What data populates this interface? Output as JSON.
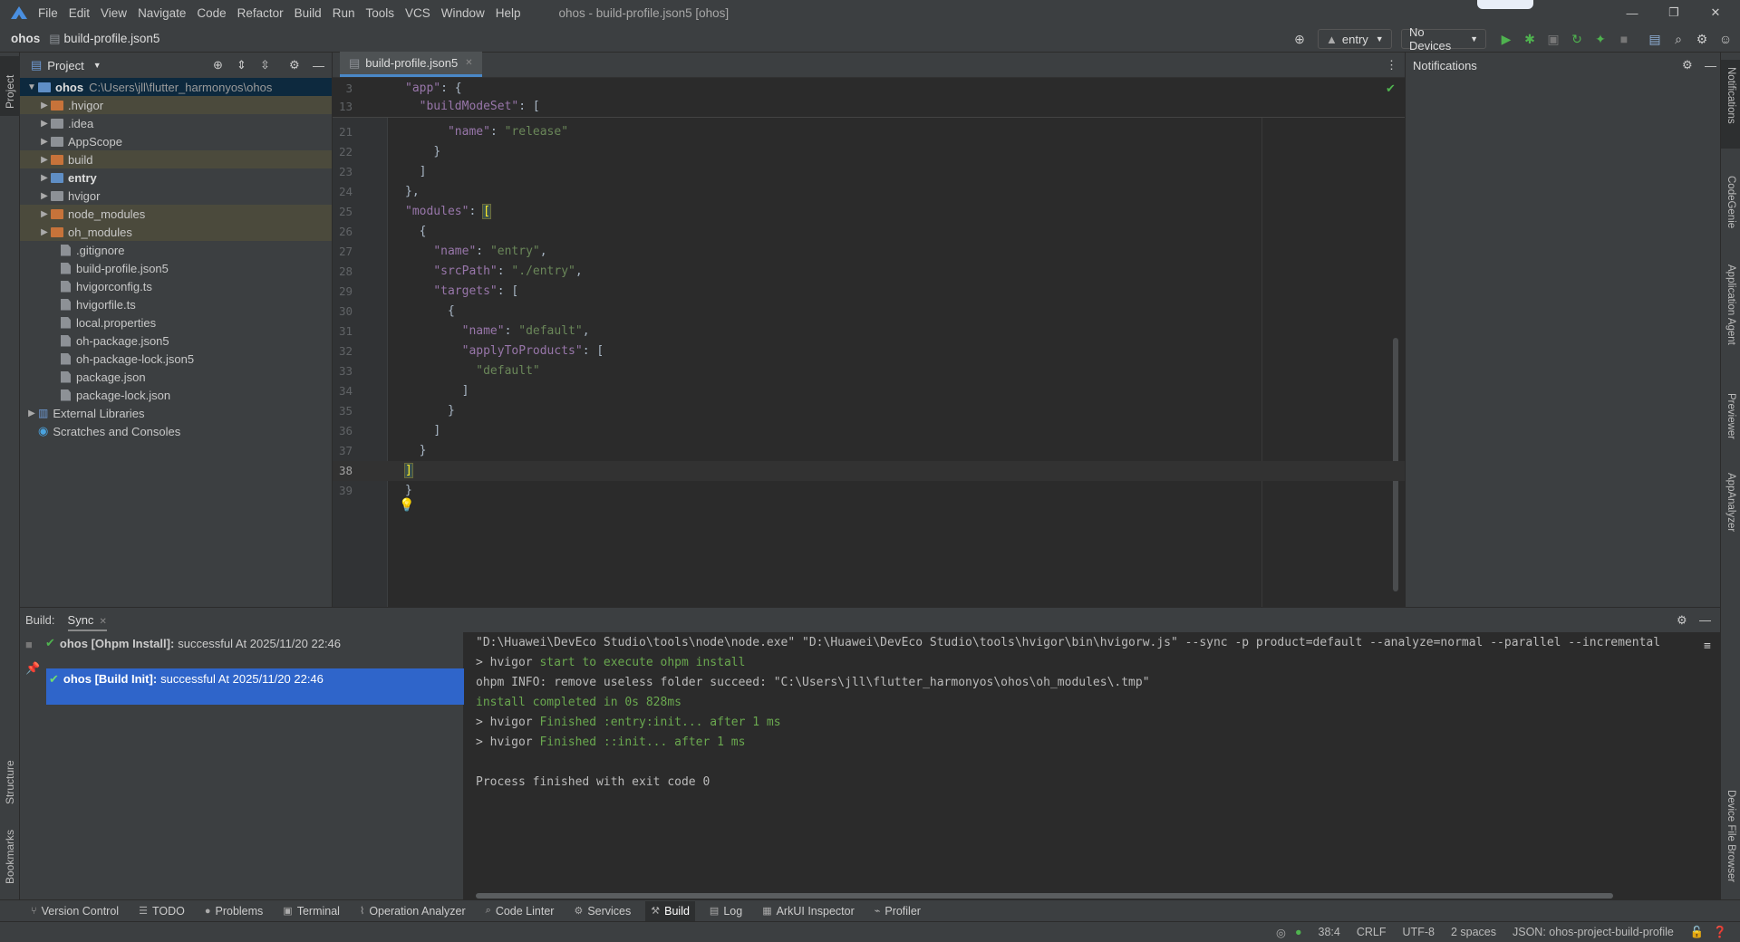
{
  "menubar": {
    "items": [
      "File",
      "Edit",
      "View",
      "Navigate",
      "Code",
      "Refactor",
      "Build",
      "Run",
      "Tools",
      "VCS",
      "Window",
      "Help"
    ],
    "window_title": "ohos - build-profile.json5 [ohos]"
  },
  "navbar": {
    "project": "ohos",
    "file": "build-profile.json5",
    "run_config": "entry",
    "device": "No Devices"
  },
  "left_strip": {
    "project": "Project",
    "structure": "Structure",
    "bookmarks": "Bookmarks"
  },
  "right_strip": {
    "notifications": "Notifications",
    "codegenie": "CodeGenie",
    "app_agent": "Application Agent",
    "previewer": "Previewer",
    "appanalyzer": "AppAnalyzer",
    "device_file_browser": "Device File Browser"
  },
  "project_panel": {
    "title": "Project",
    "root_name": "ohos",
    "root_path": "C:\\Users\\jll\\flutter_harmonyos\\ohos",
    "items": [
      {
        "label": ".hvigor",
        "kind": "folder",
        "color": "orange",
        "hl": true,
        "bold": false
      },
      {
        "label": ".idea",
        "kind": "folder",
        "color": "gray",
        "hl": false,
        "bold": false
      },
      {
        "label": "AppScope",
        "kind": "folder",
        "color": "gray",
        "hl": false,
        "bold": false
      },
      {
        "label": "build",
        "kind": "folder",
        "color": "orange",
        "hl": true,
        "bold": false
      },
      {
        "label": "entry",
        "kind": "folder",
        "color": "blue",
        "hl": false,
        "bold": true
      },
      {
        "label": "hvigor",
        "kind": "folder",
        "color": "gray",
        "hl": false,
        "bold": false
      },
      {
        "label": "node_modules",
        "kind": "folder",
        "color": "orange",
        "hl": true,
        "bold": false
      },
      {
        "label": "oh_modules",
        "kind": "folder",
        "color": "orange",
        "hl": true,
        "bold": false
      },
      {
        "label": ".gitignore",
        "kind": "file"
      },
      {
        "label": "build-profile.json5",
        "kind": "file"
      },
      {
        "label": "hvigorconfig.ts",
        "kind": "file"
      },
      {
        "label": "hvigorfile.ts",
        "kind": "file"
      },
      {
        "label": "local.properties",
        "kind": "file"
      },
      {
        "label": "oh-package.json5",
        "kind": "file"
      },
      {
        "label": "oh-package-lock.json5",
        "kind": "file"
      },
      {
        "label": "package.json",
        "kind": "file"
      },
      {
        "label": "package-lock.json",
        "kind": "file"
      }
    ],
    "external_libraries": "External Libraries",
    "scratches": "Scratches and Consoles"
  },
  "editor": {
    "tab": "build-profile.json5",
    "sticky": [
      {
        "n": "3",
        "indent": "",
        "key": "\"app\"",
        "rest": ": {"
      },
      {
        "n": "13",
        "indent": "  ",
        "key": "\"buildModeSet\"",
        "rest": ": ["
      }
    ],
    "lines": [
      {
        "n": "21",
        "indent": "      ",
        "key": "\"name\"",
        "sep": ": ",
        "val": "\"release\"",
        "tail": ""
      },
      {
        "n": "22",
        "indent": "    ",
        "key": "",
        "sep": "",
        "val": "",
        "tail": "}"
      },
      {
        "n": "23",
        "indent": "  ",
        "key": "",
        "sep": "",
        "val": "",
        "tail": "]"
      },
      {
        "n": "24",
        "indent": "},",
        "key": "",
        "sep": "",
        "val": "",
        "tail": ""
      },
      {
        "n": "25",
        "indent": "",
        "key": "\"modules\"",
        "sep": ": ",
        "val": "",
        "tail": "["
      },
      {
        "n": "26",
        "indent": "  ",
        "key": "",
        "sep": "",
        "val": "",
        "tail": "{"
      },
      {
        "n": "27",
        "indent": "    ",
        "key": "\"name\"",
        "sep": ": ",
        "val": "\"entry\"",
        "tail": ","
      },
      {
        "n": "28",
        "indent": "    ",
        "key": "\"srcPath\"",
        "sep": ": ",
        "val": "\"./entry\"",
        "tail": ","
      },
      {
        "n": "29",
        "indent": "    ",
        "key": "\"targets\"",
        "sep": ": ",
        "val": "",
        "tail": "["
      },
      {
        "n": "30",
        "indent": "      ",
        "key": "",
        "sep": "",
        "val": "",
        "tail": "{"
      },
      {
        "n": "31",
        "indent": "        ",
        "key": "\"name\"",
        "sep": ": ",
        "val": "\"default\"",
        "tail": ","
      },
      {
        "n": "32",
        "indent": "        ",
        "key": "\"applyToProducts\"",
        "sep": ": ",
        "val": "",
        "tail": "["
      },
      {
        "n": "33",
        "indent": "          ",
        "key": "",
        "sep": "",
        "val": "\"default\"",
        "tail": ""
      },
      {
        "n": "34",
        "indent": "        ",
        "key": "",
        "sep": "",
        "val": "",
        "tail": "]"
      },
      {
        "n": "35",
        "indent": "      ",
        "key": "",
        "sep": "",
        "val": "",
        "tail": "}"
      },
      {
        "n": "36",
        "indent": "    ",
        "key": "",
        "sep": "",
        "val": "",
        "tail": "]"
      },
      {
        "n": "37",
        "indent": "  ",
        "key": "",
        "sep": "",
        "val": "",
        "tail": "}"
      },
      {
        "n": "38",
        "indent": "",
        "key": "",
        "sep": "",
        "val": "",
        "tail": "]"
      },
      {
        "n": "39",
        "indent": "}",
        "key": "",
        "sep": "",
        "val": "",
        "tail": ""
      }
    ]
  },
  "notifications": {
    "title": "Notifications"
  },
  "build_panel": {
    "label": "Build:",
    "tab": "Sync",
    "entries": [
      {
        "title": "ohos [Ohpm Install]:",
        "status": "successful At 2025/11/20 22:46"
      },
      {
        "title": "ohos [Build Init]:",
        "status": "successful At 2025/11/20 22:46"
      }
    ],
    "console": [
      {
        "prefix": "\"D:\\Huawei\\DevEco Studio\\tools\\node\\node.exe\" \"D:\\Huawei\\DevEco Studio\\tools\\hvigor\\bin\\hvigorw.js\" --sync -p product=default --analyze=normal --parallel --incremental",
        "green": ""
      },
      {
        "prefix": "> hvigor ",
        "green": "start to execute ohpm install"
      },
      {
        "prefix": "ohpm INFO: remove useless folder succeed: \"C:\\Users\\jll\\flutter_harmonyos\\ohos\\oh_modules\\.tmp\"",
        "green": ""
      },
      {
        "prefix": "",
        "green": "install completed in 0s 828ms"
      },
      {
        "prefix": "> hvigor ",
        "green": "Finished :entry:init... after 1 ms"
      },
      {
        "prefix": "> hvigor ",
        "green": "Finished ::init... after 1 ms"
      },
      {
        "prefix": "",
        "green": ""
      },
      {
        "prefix": "Process finished with exit code 0",
        "green": ""
      }
    ]
  },
  "bottom_tools": [
    "Version Control",
    "TODO",
    "Problems",
    "Terminal",
    "Operation Analyzer",
    "Code Linter",
    "Services",
    "Build",
    "Log",
    "ArkUI Inspector",
    "Profiler"
  ],
  "status": {
    "position": "38:4",
    "line_sep": "CRLF",
    "encoding": "UTF-8",
    "indent": "2 spaces",
    "schema": "JSON: ohos-project-build-profile"
  }
}
